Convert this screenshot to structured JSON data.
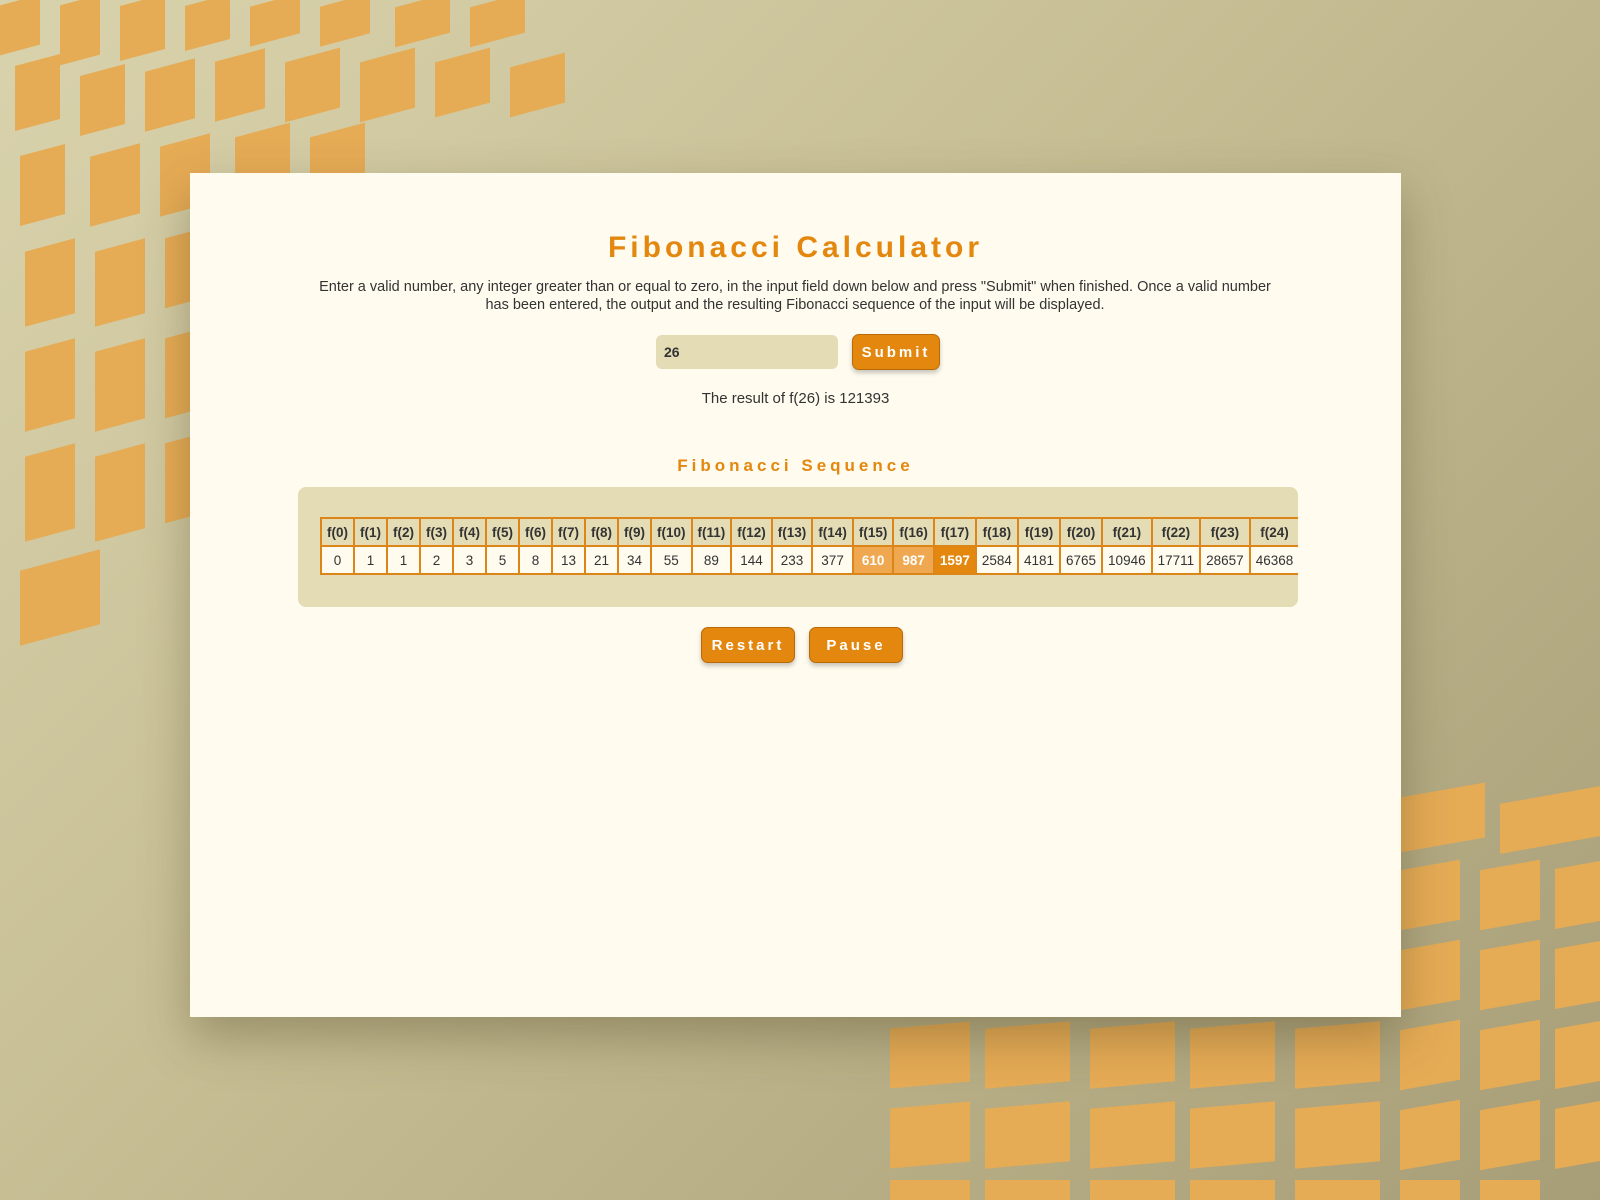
{
  "app": {
    "title": "Fibonacci Calculator",
    "description": "Enter a valid number, any integer greater than or equal to zero, in the input field down below and press \"Submit\" when finished. Once a valid number has been entered, the output and the resulting Fibonacci sequence of the input will be displayed."
  },
  "input": {
    "value": "26"
  },
  "buttons": {
    "submit": "Submit",
    "restart": "Restart",
    "pause": "Pause"
  },
  "result": {
    "text": "The result of f(26) is 121393"
  },
  "sequence": {
    "title": "Fibonacci Sequence",
    "headers": [
      "f(0)",
      "f(1)",
      "f(2)",
      "f(3)",
      "f(4)",
      "f(5)",
      "f(6)",
      "f(7)",
      "f(8)",
      "f(9)",
      "f(10)",
      "f(11)",
      "f(12)",
      "f(13)",
      "f(14)",
      "f(15)",
      "f(16)",
      "f(17)",
      "f(18)",
      "f(19)",
      "f(20)",
      "f(21)",
      "f(22)",
      "f(23)",
      "f(24)"
    ],
    "values": [
      "0",
      "1",
      "1",
      "2",
      "3",
      "5",
      "8",
      "13",
      "21",
      "34",
      "55",
      "89",
      "144",
      "233",
      "377",
      "610",
      "987",
      "1597",
      "2584",
      "4181",
      "6765",
      "10946",
      "17711",
      "28657",
      "46368"
    ],
    "highlighted_light": [
      15,
      16
    ],
    "highlighted_current": 17
  },
  "colors": {
    "accent": "#e3870f",
    "panel": "#e3dcb4",
    "card": "#fffbef"
  }
}
